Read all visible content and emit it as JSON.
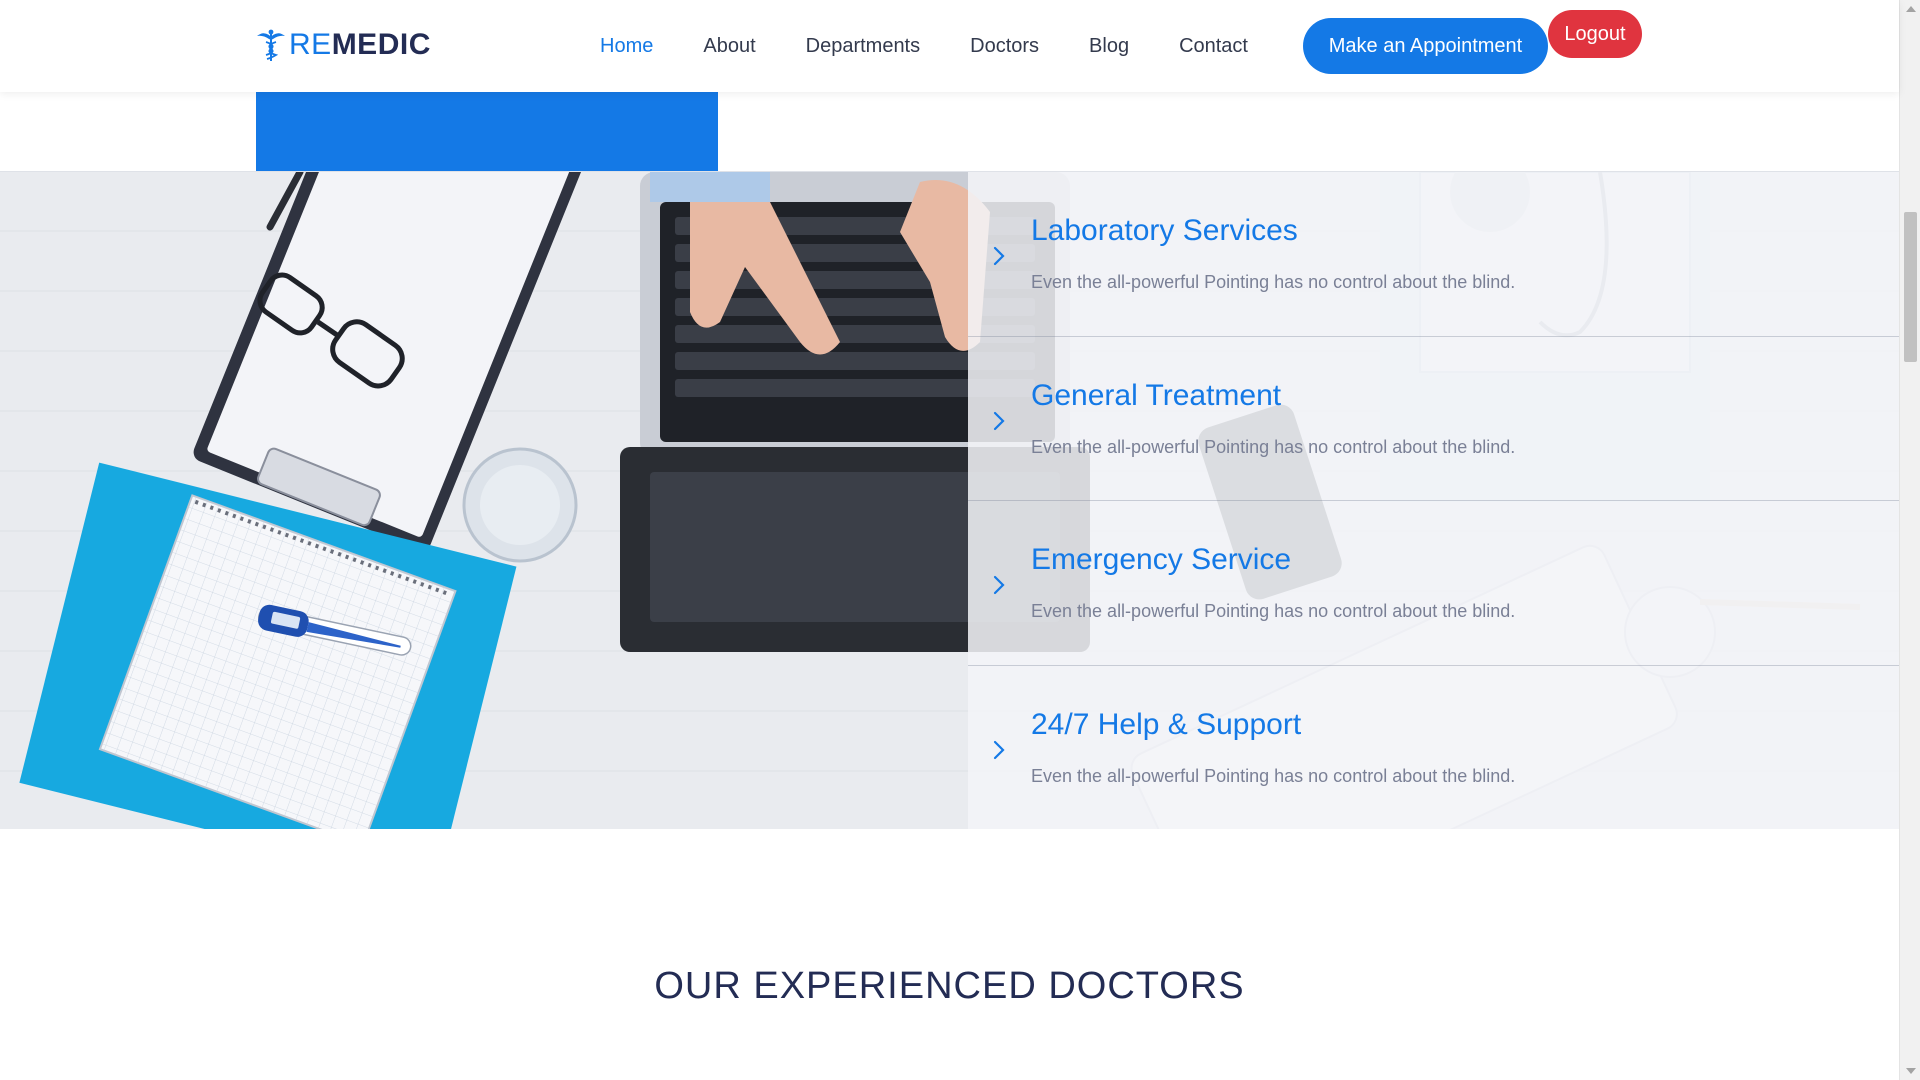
{
  "header": {
    "logo": {
      "re": "RE",
      "medic": "MEDIC",
      "icon": "caduceus-icon"
    },
    "nav": [
      {
        "label": "Home",
        "active": true
      },
      {
        "label": "About",
        "active": false
      },
      {
        "label": "Departments",
        "active": false
      },
      {
        "label": "Doctors",
        "active": false
      },
      {
        "label": "Blog",
        "active": false
      },
      {
        "label": "Contact",
        "active": false
      }
    ],
    "appointment_label": "Make an Appointment",
    "logout_label": "Logout"
  },
  "services": [
    {
      "title": "Laboratory Services",
      "description": "Even the all-powerful Pointing has no control about the blind.",
      "icon": "chevron-right-icon"
    },
    {
      "title": "General Treatment",
      "description": "Even the all-powerful Pointing has no control about the blind.",
      "icon": "chevron-right-icon"
    },
    {
      "title": "Emergency Service",
      "description": "Even the all-powerful Pointing has no control about the blind.",
      "icon": "chevron-right-icon"
    },
    {
      "title": "24/7 Help & Support",
      "description": "Even the all-powerful Pointing has no control about the blind.",
      "icon": "chevron-right-icon"
    }
  ],
  "doctors_section": {
    "heading": "OUR EXPERIENCED DOCTORS"
  },
  "colors": {
    "primary": "#1479e6",
    "logout": "#e0343f",
    "heading": "#232c54",
    "text_muted": "#7a8096"
  }
}
